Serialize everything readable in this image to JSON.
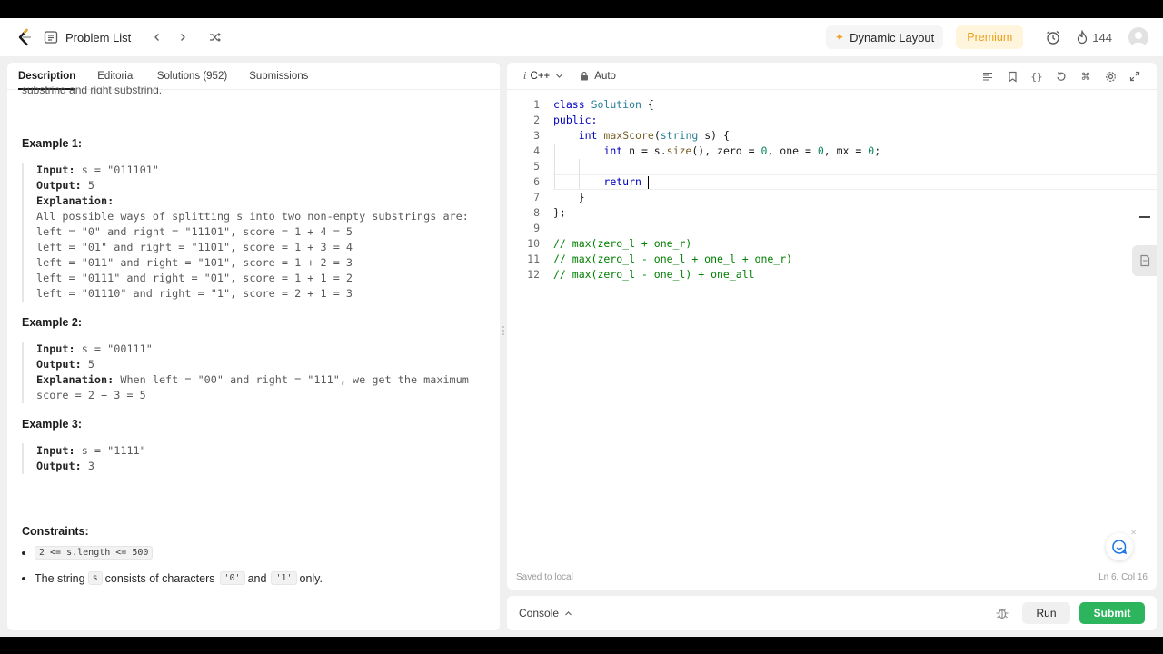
{
  "topnav": {
    "problem_list": "Problem List",
    "dynamic_layout": "Dynamic Layout",
    "premium": "Premium",
    "streak": "144"
  },
  "description_tabs": [
    {
      "label": "Description"
    },
    {
      "label": "Editorial"
    },
    {
      "label": "Solutions (952)"
    },
    {
      "label": "Submissions"
    }
  ],
  "description": {
    "cut_text": "substring and right substring.",
    "examples": [
      {
        "title": "Example 1:",
        "input_label": "Input:",
        "input_value": " s = \"011101\"",
        "output_label": "Output:",
        "output_value": " 5",
        "explanation_label": "Explanation:",
        "explanation_lines": [
          "All possible ways of splitting s into two non-empty substrings are:",
          "left = \"0\" and right = \"11101\", score = 1 + 4 = 5",
          "left = \"01\" and right = \"1101\", score = 1 + 3 = 4",
          "left = \"011\" and right = \"101\", score = 1 + 2 = 3",
          "left = \"0111\" and right = \"01\", score = 1 + 1 = 2",
          "left = \"01110\" and right = \"1\", score = 2 + 1 = 3"
        ]
      },
      {
        "title": "Example 2:",
        "input_label": "Input:",
        "input_value": " s = \"00111\"",
        "output_label": "Output:",
        "output_value": " 5",
        "explanation_label": "Explanation:",
        "explanation_inline": " When left = \"00\" and right = \"111\", we get the maximum",
        "explanation_cont": "score = 2 + 3 = 5"
      },
      {
        "title": "Example 3:",
        "input_label": "Input:",
        "input_value": " s = \"1111\"",
        "output_label": "Output:",
        "output_value": " 3"
      }
    ],
    "constraints_title": "Constraints:",
    "constraint_1": "2 <= s.length <= 500",
    "constraint_2_pre": "The string",
    "constraint_2_code1": "s",
    "constraint_2_mid": "consists of characters",
    "constraint_2_code2": "'0'",
    "constraint_2_and": "and",
    "constraint_2_code3": "'1'",
    "constraint_2_post": "only."
  },
  "editor": {
    "language_prefix": "i",
    "language": "C++",
    "mode": "Auto",
    "line_numbers": [
      "1",
      "2",
      "3",
      "4",
      "5",
      "6",
      "7",
      "8",
      "9",
      "10",
      "11",
      "12"
    ],
    "code": {
      "l1_a": "class",
      "l1_b": " ",
      "l1_c": "Solution",
      "l1_d": " {",
      "l2": "public:",
      "l3_a": "    ",
      "l3_b": "int",
      "l3_c": " ",
      "l3_d": "maxScore",
      "l3_e": "(",
      "l3_f": "string",
      "l3_g": " s) {",
      "l4_a": "        ",
      "l4_b": "int",
      "l4_c": " n = s.",
      "l4_d": "size",
      "l4_e": "(), zero = ",
      "l4_f": "0",
      "l4_g": ", one = ",
      "l4_h": "0",
      "l4_i": ", mx = ",
      "l4_j": "0",
      "l4_k": ";",
      "l5": "",
      "l6_a": "        ",
      "l6_b": "return",
      "l6_c": " ",
      "l7": "    }",
      "l8": "};",
      "l9": "",
      "l10": "// max(zero_l + one_r)",
      "l11": "// max(zero_l - one_l + one_l + one_r)",
      "l12": "// max(zero_l - one_l) + one_all"
    },
    "saved_status": "Saved to local",
    "cursor_position": "Ln 6, Col 16"
  },
  "console_bar": {
    "console_label": "Console",
    "run_label": "Run",
    "submit_label": "Submit"
  },
  "colors": {
    "accent_green": "#2db55d",
    "premium_text": "#e8a01a",
    "keyword_blue": "#0000c0",
    "comment_green": "#008000"
  },
  "icons": [
    "leetcode-logo-icon",
    "problem-list-icon",
    "chevron-left-icon",
    "chevron-right-icon",
    "shuffle-icon",
    "sparkle-icon",
    "alarm-clock-icon",
    "flame-icon",
    "avatar-icon",
    "lock-icon",
    "format-icon",
    "bookmark-icon",
    "braces-icon",
    "reset-icon",
    "command-icon",
    "settings-icon",
    "expand-icon",
    "note-icon",
    "chat-icon",
    "bug-icon"
  ]
}
